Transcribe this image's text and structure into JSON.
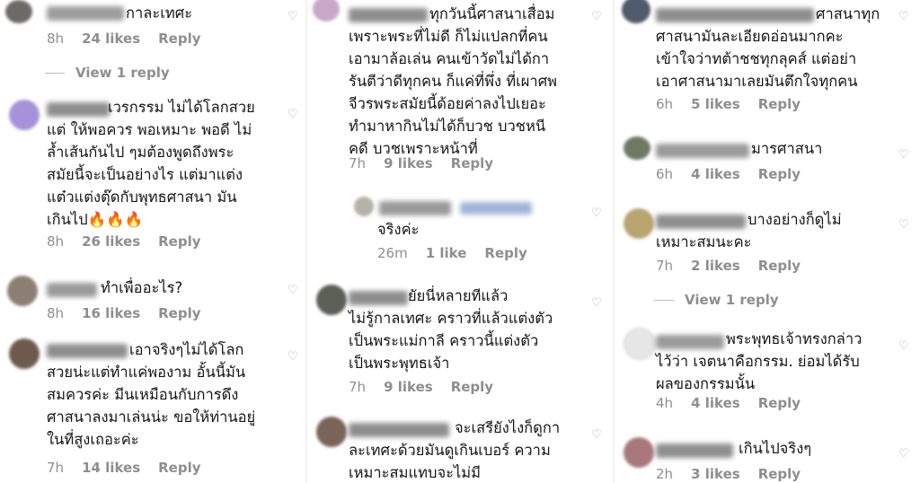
{
  "columns": [
    {
      "comments": [
        {
          "text": "กาละเทศะ",
          "time": "8h",
          "likes": "24 likes",
          "reply": "Reply",
          "view_replies": "View 1 reply"
        },
        {
          "text": "เวรกรรม ไม่ได้โลกสวย\nแต่ ให้พอควร พอเหมาะ พอดี ไม่\nล้ำเส้นกันไป ๆมต้องพูดถึงพระ\nสมัยนี้จะเป็นอย่างไร แต่มาแต่ง\nแต๋วแต่งตุ๊ดกับพุทธศาสนา มัน\nเกินไป🔥🔥🔥",
          "time": "8h",
          "likes": "26 likes",
          "reply": "Reply"
        },
        {
          "text": "ทำเพื่ออะไร?",
          "time": "8h",
          "likes": "16 likes",
          "reply": "Reply"
        },
        {
          "text": "เอาจริงๆไม่ได้โลก\nสวยน่ะแต่ทำแค่พองาม อั้นนี้มัน\nสมควรค่ะ มีนเหมือนกับการดึง\nศาสนาลงมาเล่นน่ะ ขอให้ท่านอยู่\nในที่สูงเถอะค่ะ",
          "time": "7h",
          "likes": "14 likes",
          "reply": "Reply"
        }
      ]
    },
    {
      "comments": [
        {
          "text": "ทุกวันนี้ศาสนาเสื่อม\nเพราะพระที่ไม่ดี ก็ไม่แปลกที่คน\nเอามาล้อเล่น คนเข้าวัดไม่ได้กา\nรันตีว่าดีทุกคน ก็แค่ที่พึ่ง ที่เผาศพ\nจีวรพระสมัยนี้ด้อยค่าลงไปเยอะ\nทำมาหากินไม่ได้ก็บวช บวชหนี\nคดี บวชเพราะหน้าที่",
          "time": "7h",
          "likes": "9 likes",
          "reply": "Reply"
        },
        {
          "text": "จริงค่ะ",
          "time": "26m",
          "likes": "1 like",
          "reply": "Reply"
        },
        {
          "text": "ยัยนี่หลายทีแล้ว\nไม่รู้กาลเทศะ คราวที่แล้วแต่งตัว\nเป็นพระแม่กาลี คราวนี้แต่งตัว\nเป็นพระพุทธเจ้า",
          "time": "7h",
          "likes": "9 likes",
          "reply": "Reply"
        },
        {
          "text": "จะเสรียังไงก็ดูกา\nละเทศะด้วยมันดูเกินเบอร์ ความ\nเหมาะสมแทบจะไม่มี",
          "time": "",
          "likes": "",
          "reply": ""
        }
      ]
    },
    {
      "comments": [
        {
          "text": "ศาสนาทุก\nศาสนามันละเอียดอ่อนมากคะ\nเข้าใจว่าทต้าชชทุกลุคส์ แต่อย่า\nเอาศาสนามาเลยมันตึกใจทุกคน",
          "time": "6h",
          "likes": "5 likes",
          "reply": "Reply"
        },
        {
          "text": "มารศาสนา",
          "time": "6h",
          "likes": "4 likes",
          "reply": "Reply"
        },
        {
          "text": "บางอย่างก็ดูไม่\nเหมาะสมนะคะ",
          "time": "7h",
          "likes": "2 likes",
          "reply": "Reply",
          "view_replies": "View 1 reply"
        },
        {
          "text": "พระพุทธเจ้าทรงกล่าว\nไว้ว่า เจตนาคือกรรม. ย่อมได้รับ\nผลของกรรมนั้น",
          "time": "4h",
          "likes": "4 likes",
          "reply": "Reply"
        },
        {
          "text": "เกินไปจริงๆ",
          "time": "2h",
          "likes": "3 likes",
          "reply": "Reply"
        }
      ]
    }
  ],
  "icons": {
    "like": "heart-outline-icon"
  },
  "colors": {
    "meta": "#8e8e8e",
    "text": "#151515",
    "heart": "#a8a8a8"
  }
}
